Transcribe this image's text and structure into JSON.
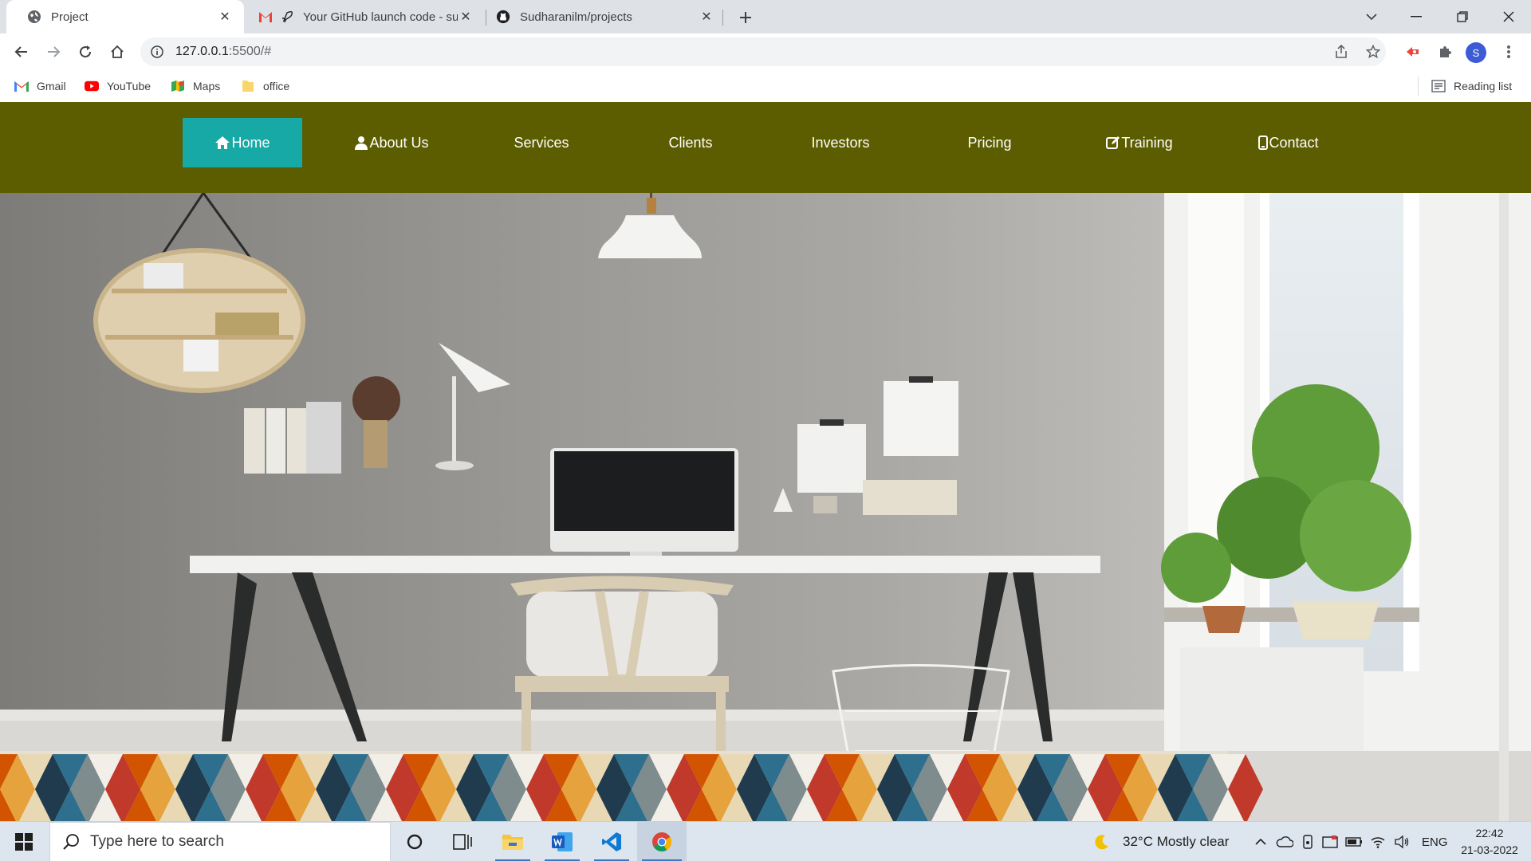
{
  "browser": {
    "tabs": [
      {
        "title": "Project",
        "active": true
      },
      {
        "title": "Your GitHub launch code - su",
        "active": false
      },
      {
        "title": "Sudharanilm/projects",
        "active": false
      }
    ],
    "url_host": "127.0.0.1",
    "url_rest": ":5500/#",
    "profile_initial": "S",
    "bookmarks": [
      {
        "label": "Gmail",
        "icon": "gmail-icon"
      },
      {
        "label": "YouTube",
        "icon": "youtube-icon"
      },
      {
        "label": "Maps",
        "icon": "maps-icon"
      },
      {
        "label": "office",
        "icon": "folder-icon"
      }
    ],
    "reading_list": "Reading list"
  },
  "site": {
    "nav": [
      {
        "label": "Home",
        "icon": "home-icon",
        "active": true
      },
      {
        "label": "About Us",
        "icon": "user-icon",
        "active": false
      },
      {
        "label": "Services",
        "icon": "",
        "active": false
      },
      {
        "label": "Clients",
        "icon": "",
        "active": false
      },
      {
        "label": "Investors",
        "icon": "",
        "active": false
      },
      {
        "label": "Pricing",
        "icon": "",
        "active": false
      },
      {
        "label": "Training",
        "icon": "edit-icon",
        "active": false
      },
      {
        "label": "Contact",
        "icon": "phone-icon",
        "active": false
      }
    ],
    "colors": {
      "nav_bg": "#5c5c00",
      "nav_active": "#17a9a6",
      "nav_text": "#ffffff"
    }
  },
  "taskbar": {
    "search_placeholder": "Type here to search",
    "weather": "32°C  Mostly clear",
    "language": "ENG",
    "time": "22:42",
    "date": "21-03-2022"
  }
}
